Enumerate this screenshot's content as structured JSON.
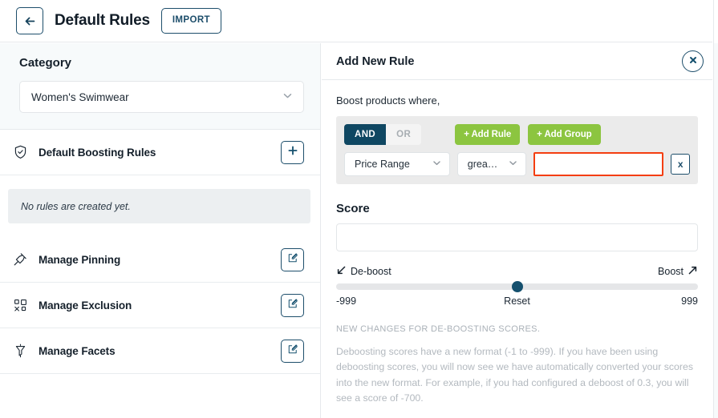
{
  "topbar": {
    "back_icon": "arrow-left-icon",
    "title": "Default Rules",
    "import_label": "IMPORT"
  },
  "sidebar": {
    "category": {
      "label": "Category",
      "selected": "Women's Swimwear",
      "chevron_icon": "chevron-down-icon"
    },
    "boosting": {
      "icon": "shield-check-icon",
      "title": "Default Boosting Rules",
      "add_label": "+",
      "empty_text": "No rules are created yet."
    },
    "items": [
      {
        "icon": "pin-icon",
        "label": "Manage Pinning",
        "action_icon": "edit-icon"
      },
      {
        "icon": "exclusion-icon",
        "label": "Manage Exclusion",
        "action_icon": "edit-icon"
      },
      {
        "icon": "funnel-icon",
        "label": "Manage Facets",
        "action_icon": "edit-icon"
      }
    ]
  },
  "panel": {
    "title": "Add New Rule",
    "close_icon": "close-icon",
    "boost_prompt": "Boost products where,",
    "builder": {
      "conjunction_and": "AND",
      "conjunction_or": "OR",
      "active_conjunction": "AND",
      "add_rule_label": "+ Add Rule",
      "add_group_label": "+ Add Group",
      "field_value": "Price Range",
      "operator_value": "grea…",
      "value_input": "",
      "value_placeholder": "",
      "remove_label": "x",
      "chevron_icon": "chevron-down-icon"
    },
    "score": {
      "label": "Score",
      "input_value": "",
      "input_placeholder": "",
      "deboost_label": "De-boost",
      "deboost_icon": "arrow-down-left-icon",
      "boost_label": "Boost",
      "boost_icon": "arrow-up-right-icon",
      "min_label": "-999",
      "max_label": "999",
      "reset_label": "Reset",
      "slider_value": 0,
      "slider_min": -999,
      "slider_max": 999
    },
    "notice": {
      "heading": "NEW CHANGES FOR DE-BOOSTING SCORES.",
      "body": "Deboosting scores have a new format (-1 to -999). If you have been using deboosting scores, you will now see we have automatically converted your scores into the new format. For example, if you had configured a deboost of 0.3, you will see a score of -700."
    }
  },
  "colors": {
    "navy": "#0f4762",
    "green": "#8cc540",
    "error_red": "#f43e10",
    "panel_grey": "#ebebeb",
    "empty_grey": "#eceff1"
  }
}
